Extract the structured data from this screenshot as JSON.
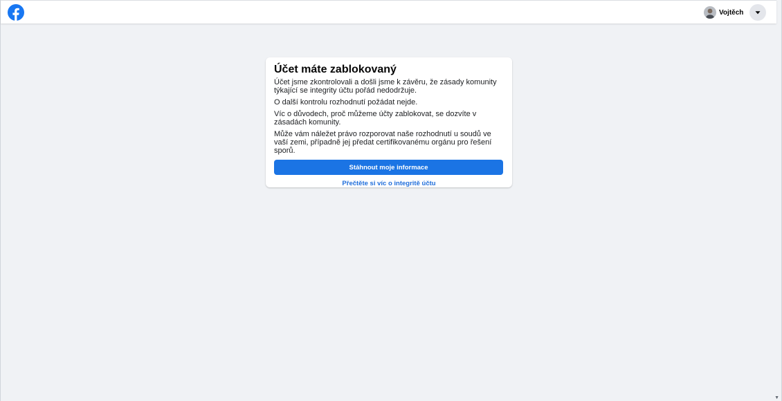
{
  "header": {
    "logo_icon": "facebook-logo-icon",
    "brand_color": "#1877f2",
    "profile_name": "Vojtěch",
    "avatar_icon": "user-avatar",
    "menu_icon": "caret-down-icon"
  },
  "card": {
    "title": "Účet máte zablokovaný",
    "paragraphs": [
      "Účet jsme zkontrolovali a došli jsme k závěru, že zásady komunity týkající se integrity účtu pořád nedodržuje.",
      "O další kontrolu rozhodnutí požádat nejde.",
      "Víc o důvodech, proč můžeme účty zablokovat, se dozvíte v zásadách komunity.",
      "Může vám náležet právo rozporovat naše rozhodnutí u soudů ve vaší zemi, případně jej předat certifikovanému orgánu pro řešení sporů."
    ],
    "primary_button_label": "Stáhnout moje informace",
    "primary_button_color": "#1b74e4",
    "link_label": "Přečtěte si víc o integritě účtu",
    "link_color": "#216fdb"
  },
  "colors": {
    "background": "#f0f2f5",
    "card": "#ffffff"
  }
}
